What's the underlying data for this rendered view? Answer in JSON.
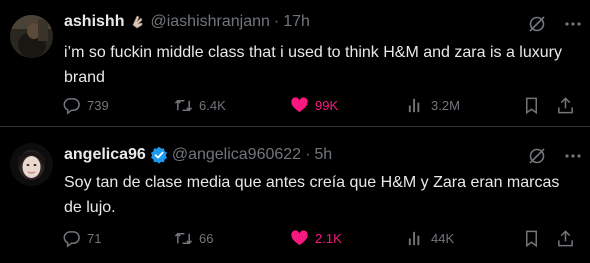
{
  "tweets": [
    {
      "name": "ashishh",
      "handle": "@iashishranjann",
      "separator": "·",
      "time": "17h",
      "text": "i’m so fuckin middle class that i used to think H&M and zara is a luxury brand",
      "stats": {
        "replies": "739",
        "retweets": "6.4K",
        "likes": "99K",
        "views": "3.2M"
      },
      "liked": true,
      "verified": false
    },
    {
      "name": "angelica96",
      "handle": "@angelica960622",
      "separator": "·",
      "time": "5h",
      "text": "Soy tan de clase media que antes creía que H&M y Zara eran marcas de lujo.",
      "stats": {
        "replies": "71",
        "retweets": "66",
        "likes": "2.1K",
        "views": "44K"
      },
      "liked": true,
      "verified": true
    }
  ],
  "colors": {
    "background": "#000000",
    "text": "#e7e9ea",
    "muted": "#71767b",
    "like": "#f91880",
    "verified": "#1d9bf0",
    "divider": "#2f3336"
  },
  "icons": [
    "reply-icon",
    "retweet-icon",
    "like-icon",
    "views-icon",
    "bookmark-icon",
    "share-icon",
    "grok-icon",
    "more-icon",
    "verified-badge-icon",
    "hand-emoji-icon"
  ]
}
